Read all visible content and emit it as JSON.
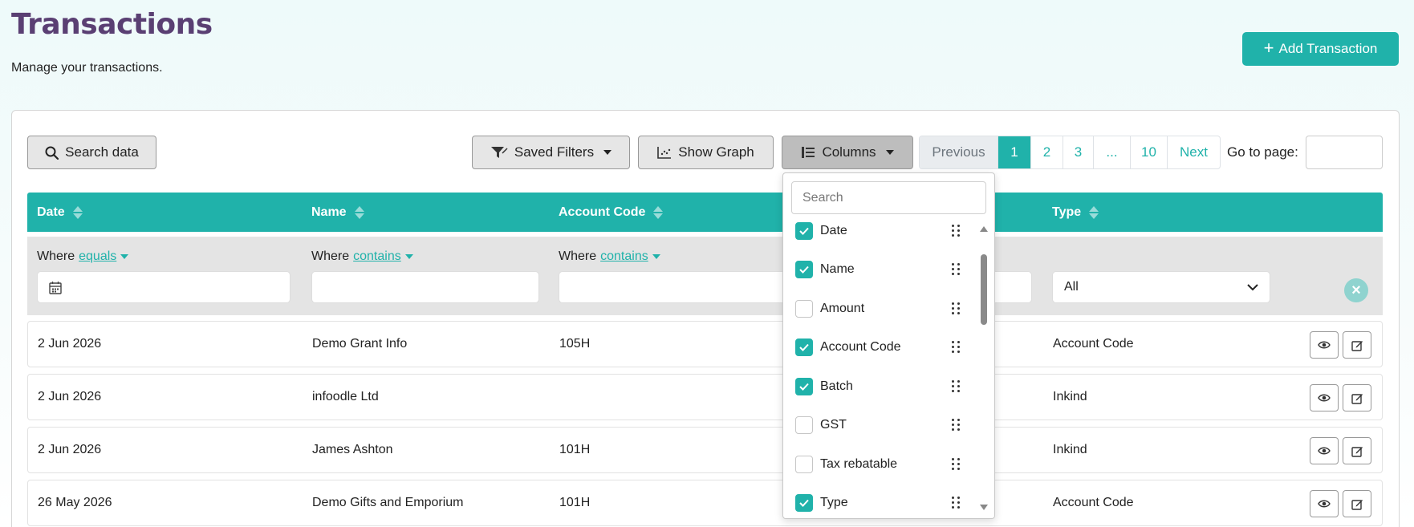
{
  "header": {
    "title": "Transactions",
    "subtitle": "Manage your transactions.",
    "add_button_label": "Add Transaction"
  },
  "toolbar": {
    "search_label": "Search data",
    "saved_filters_label": "Saved Filters",
    "show_graph_label": "Show Graph",
    "columns_label": "Columns"
  },
  "pagination": {
    "previous": "Previous",
    "pages": [
      "1",
      "2",
      "3",
      "...",
      "10"
    ],
    "current": "1",
    "next": "Next",
    "goto_label": "Go to page:"
  },
  "table": {
    "headers": {
      "date": "Date",
      "name": "Name",
      "account_code": "Account Code",
      "type": "Type"
    },
    "filters": {
      "where_label": "Where",
      "date_op": "equals",
      "name_op": "contains",
      "account_code_op": "contains",
      "type_value": "All"
    },
    "rows": [
      {
        "date": "2 Jun 2026",
        "name": "Demo Grant Info",
        "account_code": "105H",
        "type": "Account Code"
      },
      {
        "date": "2 Jun 2026",
        "name": "infoodle Ltd",
        "account_code": "",
        "type": "Inkind"
      },
      {
        "date": "2 Jun 2026",
        "name": "James Ashton",
        "account_code": "101H",
        "type": "Inkind"
      },
      {
        "date": "26 May 2026",
        "name": "Demo Gifts and Emporium",
        "account_code": "101H",
        "type": "Account Code"
      }
    ]
  },
  "columns_dropdown": {
    "search_placeholder": "Search",
    "items": [
      {
        "label": "Date",
        "checked": true
      },
      {
        "label": "Name",
        "checked": true
      },
      {
        "label": "Amount",
        "checked": false
      },
      {
        "label": "Account Code",
        "checked": true
      },
      {
        "label": "Batch",
        "checked": true
      },
      {
        "label": "GST",
        "checked": false
      },
      {
        "label": "Tax rebatable",
        "checked": false
      },
      {
        "label": "Type",
        "checked": true
      }
    ]
  },
  "colors": {
    "accent": "#20b2aa",
    "title": "#5a3f73"
  }
}
